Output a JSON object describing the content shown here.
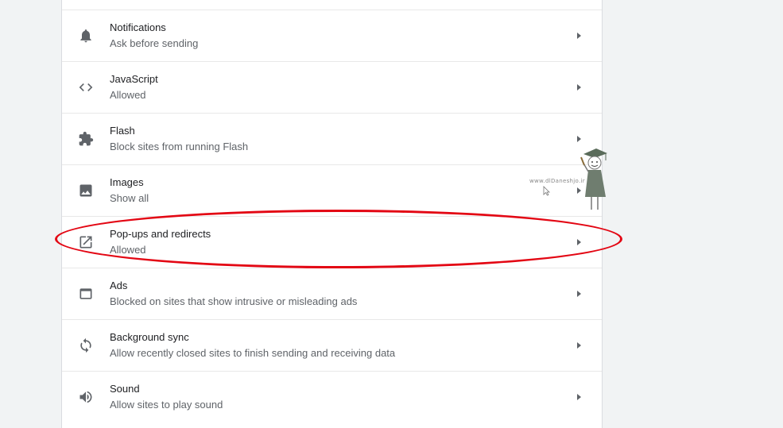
{
  "settings_rows": [
    {
      "title": "Notifications",
      "subtitle": "Ask before sending",
      "icon": "bell-icon"
    },
    {
      "title": "JavaScript",
      "subtitle": "Allowed",
      "icon": "code-icon"
    },
    {
      "title": "Flash",
      "subtitle": "Block sites from running Flash",
      "icon": "puzzle-icon"
    },
    {
      "title": "Images",
      "subtitle": "Show all",
      "icon": "image-icon"
    },
    {
      "title": "Pop-ups and redirects",
      "subtitle": "Allowed",
      "icon": "open-in-new-icon"
    },
    {
      "title": "Ads",
      "subtitle": "Blocked on sites that show intrusive or misleading ads",
      "icon": "browser-window-icon"
    },
    {
      "title": "Background sync",
      "subtitle": "Allow recently closed sites to finish sending and receiving data",
      "icon": "sync-icon"
    },
    {
      "title": "Sound",
      "subtitle": "Allow sites to play sound",
      "icon": "speaker-icon"
    }
  ],
  "watermark": {
    "text": "www.dlDaneshjo.ir"
  },
  "colors": {
    "highlight": "#e30613",
    "icon": "#5f6368",
    "title_text": "#202124",
    "subtitle_text": "#5f6368",
    "page_background": "#f1f3f4"
  }
}
